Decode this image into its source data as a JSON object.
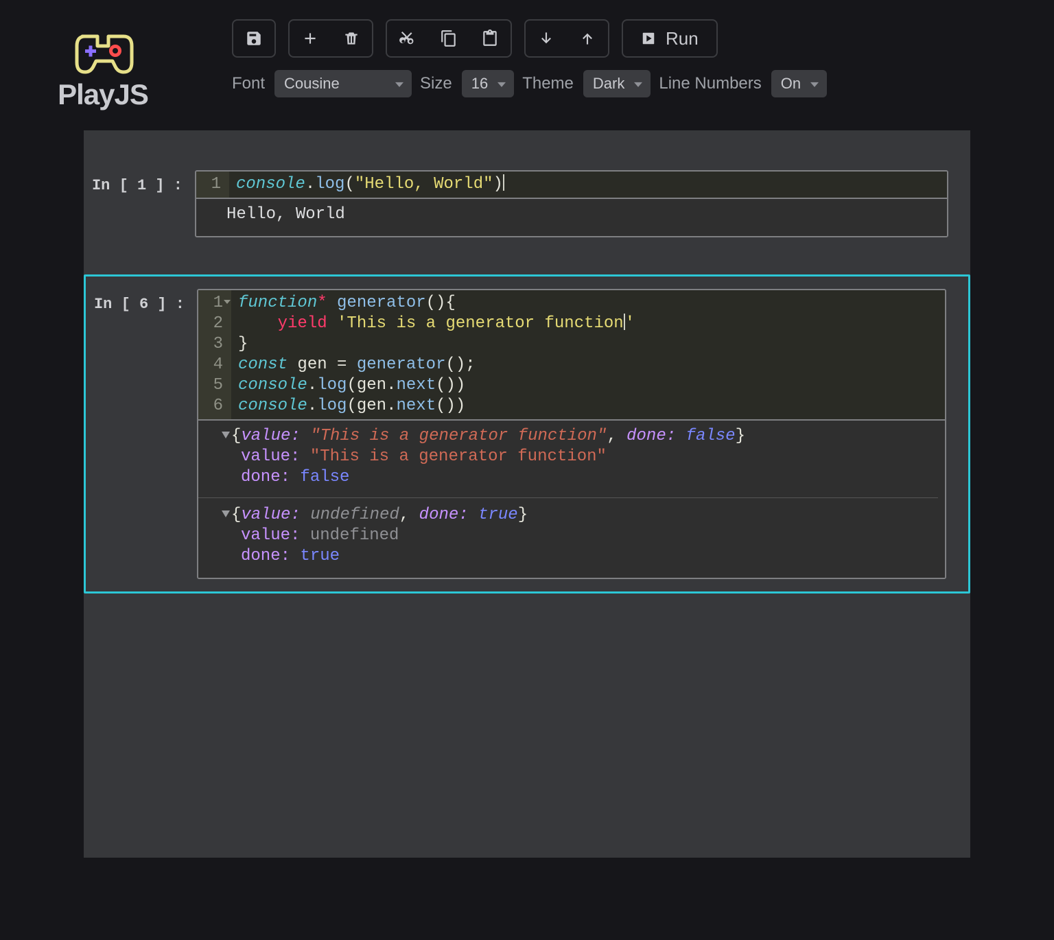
{
  "app": {
    "name": "PlayJS"
  },
  "toolbar": {
    "run_label": "Run"
  },
  "settings": {
    "font_label": "Font",
    "font_value": "Cousine",
    "size_label": "Size",
    "size_value": "16",
    "theme_label": "Theme",
    "theme_value": "Dark",
    "line_numbers_label": "Line Numbers",
    "line_numbers_value": "On"
  },
  "cells": [
    {
      "prompt": "In [ 1 ] :",
      "line_numbers": [
        "1"
      ],
      "code_tokens": [
        [
          {
            "t": "console",
            "c": "kw-it"
          },
          {
            "t": ".",
            "c": "dot"
          },
          {
            "t": "log",
            "c": "fn"
          },
          {
            "t": "(",
            "c": "paren"
          },
          {
            "t": "\"Hello, World\"",
            "c": "str"
          },
          {
            "t": ")",
            "c": "paren"
          },
          {
            "t": "",
            "c": "cursor"
          }
        ]
      ],
      "output_plain": "Hello, World"
    },
    {
      "prompt": "In [ 6 ] :",
      "line_numbers": [
        "1",
        "2",
        "3",
        "4",
        "5",
        "6"
      ],
      "fold_lines": [
        0
      ],
      "code_tokens": [
        [
          {
            "t": "function",
            "c": "kw-it"
          },
          {
            "t": "*",
            "c": "star"
          },
          {
            "t": " ",
            "c": "op"
          },
          {
            "t": "generator",
            "c": "fn"
          },
          {
            "t": "()",
            "c": "paren"
          },
          {
            "t": "{",
            "c": "paren"
          }
        ],
        [
          {
            "t": "    ",
            "c": "op"
          },
          {
            "t": "yield",
            "c": "yield"
          },
          {
            "t": " ",
            "c": "op"
          },
          {
            "t": "'This is a generator function",
            "c": "str"
          },
          {
            "t": "",
            "c": "cursor"
          },
          {
            "t": "'",
            "c": "str"
          }
        ],
        [
          {
            "t": "}",
            "c": "paren"
          }
        ],
        [
          {
            "t": "const",
            "c": "kw-it"
          },
          {
            "t": " gen ",
            "c": "name"
          },
          {
            "t": "=",
            "c": "op"
          },
          {
            "t": " ",
            "c": "op"
          },
          {
            "t": "generator",
            "c": "fn"
          },
          {
            "t": "();",
            "c": "paren"
          }
        ],
        [
          {
            "t": "console",
            "c": "kw-it"
          },
          {
            "t": ".",
            "c": "dot"
          },
          {
            "t": "log",
            "c": "fn"
          },
          {
            "t": "(",
            "c": "paren"
          },
          {
            "t": "gen",
            "c": "name"
          },
          {
            "t": ".",
            "c": "dot"
          },
          {
            "t": "next",
            "c": "fn"
          },
          {
            "t": "())",
            "c": "paren"
          }
        ],
        [
          {
            "t": "console",
            "c": "kw-it"
          },
          {
            "t": ".",
            "c": "dot"
          },
          {
            "t": "log",
            "c": "fn"
          },
          {
            "t": "(",
            "c": "paren"
          },
          {
            "t": "gen",
            "c": "name"
          },
          {
            "t": ".",
            "c": "dot"
          },
          {
            "t": "next",
            "c": "fn"
          },
          {
            "t": "())",
            "c": "paren"
          }
        ]
      ],
      "output_objects": [
        {
          "summary": [
            {
              "t": "{",
              "c": "out-pun"
            },
            {
              "t": "value:",
              "c": "out-key"
            },
            {
              "t": " ",
              "c": "out-pun"
            },
            {
              "t": "\"This is a generator function\"",
              "c": "out-str"
            },
            {
              "t": ", ",
              "c": "out-pun"
            },
            {
              "t": "done:",
              "c": "out-key"
            },
            {
              "t": " ",
              "c": "out-pun"
            },
            {
              "t": "false",
              "c": "out-bool"
            },
            {
              "t": "}",
              "c": "out-pun"
            }
          ],
          "expanded": [
            [
              {
                "t": "value:",
                "c": "out-keyp"
              },
              {
                "t": " ",
                "c": "out-pun"
              },
              {
                "t": "\"This is a generator function\"",
                "c": "out-strp"
              }
            ],
            [
              {
                "t": "done:",
                "c": "out-keyp"
              },
              {
                "t": " ",
                "c": "out-pun"
              },
              {
                "t": "false",
                "c": "out-boolp"
              }
            ]
          ]
        },
        {
          "summary": [
            {
              "t": "{",
              "c": "out-pun"
            },
            {
              "t": "value:",
              "c": "out-key"
            },
            {
              "t": " ",
              "c": "out-pun"
            },
            {
              "t": "undefined",
              "c": "out-und"
            },
            {
              "t": ", ",
              "c": "out-pun"
            },
            {
              "t": "done:",
              "c": "out-key"
            },
            {
              "t": " ",
              "c": "out-pun"
            },
            {
              "t": "true",
              "c": "out-bool"
            },
            {
              "t": "}",
              "c": "out-pun"
            }
          ],
          "expanded": [
            [
              {
                "t": "value:",
                "c": "out-keyp"
              },
              {
                "t": " ",
                "c": "out-pun"
              },
              {
                "t": "undefined",
                "c": "out-undp"
              }
            ],
            [
              {
                "t": "done:",
                "c": "out-keyp"
              },
              {
                "t": " ",
                "c": "out-pun"
              },
              {
                "t": "true",
                "c": "out-boolp"
              }
            ]
          ]
        }
      ]
    }
  ]
}
